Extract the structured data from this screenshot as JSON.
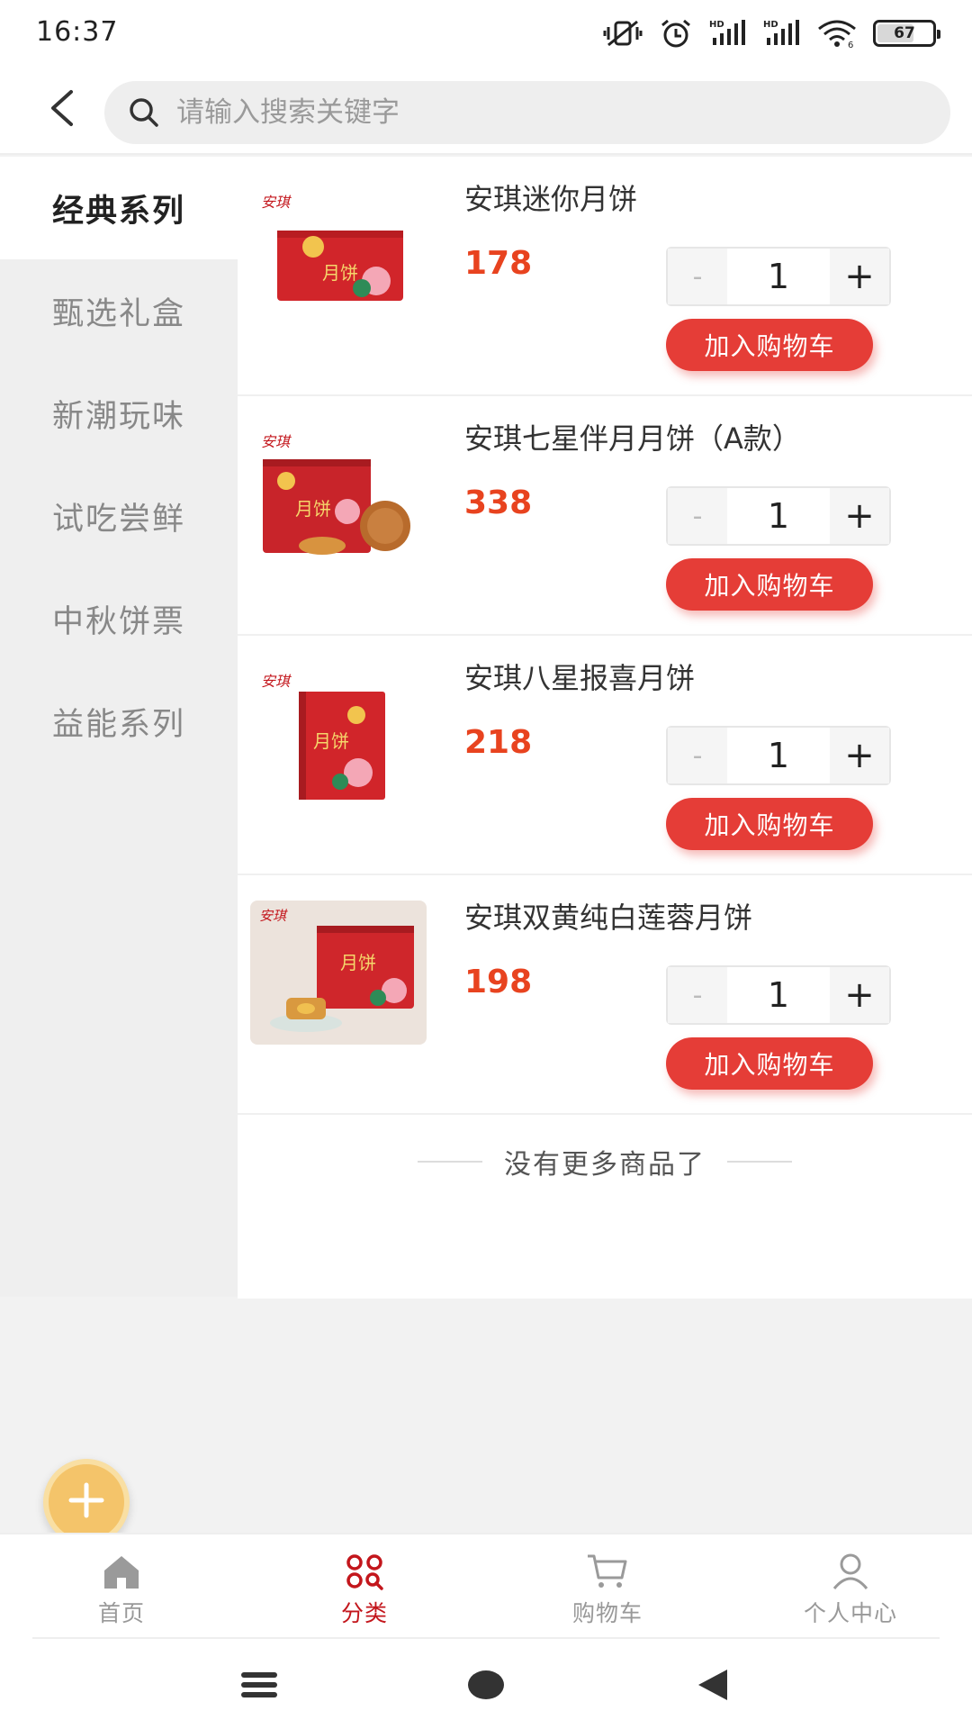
{
  "status_bar": {
    "time": "16:37",
    "battery": 67,
    "battery_label": "67",
    "icons": [
      "mute-vibrate-icon",
      "alarm-icon",
      "hd-signal-icon",
      "hd-signal-icon",
      "wifi-icon",
      "battery-icon"
    ],
    "signal_label": "HD",
    "wifi_label": "6"
  },
  "header": {
    "back_icon": "chevron-left-icon",
    "search_placeholder": "请输入搜索关键字"
  },
  "sidebar": {
    "items": [
      {
        "label": "经典系列",
        "active": true
      },
      {
        "label": "甄选礼盒",
        "active": false
      },
      {
        "label": "新潮玩味",
        "active": false
      },
      {
        "label": "试吃尝鲜",
        "active": false
      },
      {
        "label": "中秋饼票",
        "active": false
      },
      {
        "label": "益能系列",
        "active": false
      }
    ]
  },
  "products": [
    {
      "name": "安琪迷你月饼",
      "price": "178",
      "quantity": "1",
      "minus": "-",
      "plus": "+",
      "add_label": "加入购物车",
      "logo": "安琪",
      "box_text": "月饼"
    },
    {
      "name": "安琪七星伴月月饼（A款）",
      "price": "338",
      "quantity": "1",
      "minus": "-",
      "plus": "+",
      "add_label": "加入购物车",
      "logo": "安琪",
      "box_text": "月饼"
    },
    {
      "name": "安琪八星报喜月饼",
      "price": "218",
      "quantity": "1",
      "minus": "-",
      "plus": "+",
      "add_label": "加入购物车",
      "logo": "安琪",
      "box_text": "月饼"
    },
    {
      "name": "安琪双黄纯白莲蓉月饼",
      "price": "198",
      "quantity": "1",
      "minus": "-",
      "plus": "+",
      "add_label": "加入购物车",
      "logo": "安琪",
      "box_text": "月饼"
    }
  ],
  "list_footer": "没有更多商品了",
  "tabbar": {
    "items": [
      {
        "label": "首页",
        "icon": "home-icon",
        "active": false
      },
      {
        "label": "分类",
        "icon": "category-icon",
        "active": true
      },
      {
        "label": "购物车",
        "icon": "cart-icon",
        "active": false
      },
      {
        "label": "个人中心",
        "icon": "user-icon",
        "active": false
      }
    ]
  },
  "colors": {
    "accent": "#e53d37",
    "price": "#e8431f",
    "tab_active": "#c3161c",
    "fab": "#f4c46a"
  }
}
